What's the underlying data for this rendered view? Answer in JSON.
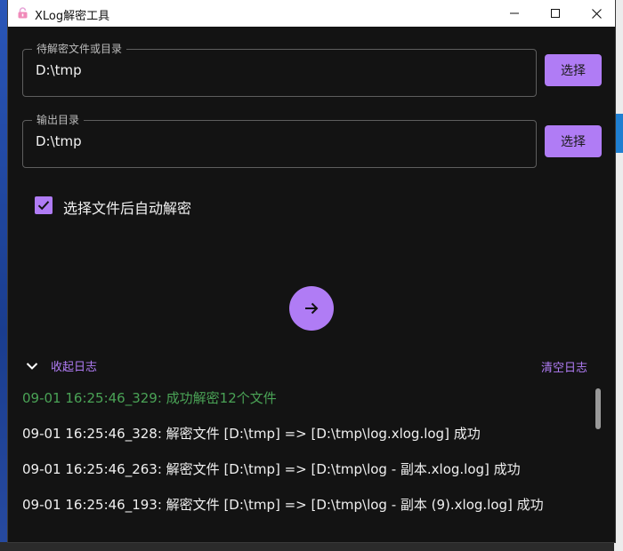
{
  "window": {
    "title": "XLog解密工具"
  },
  "input_dir": {
    "label": "待解密文件或目录",
    "value": "D:\\tmp",
    "button": "选择"
  },
  "output_dir": {
    "label": "输出目录",
    "value": "D:\\tmp",
    "button": "选择"
  },
  "auto_decrypt": {
    "label": "选择文件后自动解密",
    "checked": true
  },
  "log": {
    "collapse_label": "收起日志",
    "clear_label": "清空日志",
    "lines": [
      "09-01 16:25:46_329: 成功解密12个文件",
      "09-01 16:25:46_328: 解密文件 [D:\\tmp] => [D:\\tmp\\log.xlog.log] 成功",
      "09-01 16:25:46_263: 解密文件 [D:\\tmp] => [D:\\tmp\\log - 副本.xlog.log] 成功",
      "09-01 16:25:46_193: 解密文件 [D:\\tmp] => [D:\\tmp\\log - 副本 (9).xlog.log] 成功"
    ]
  },
  "colors": {
    "accent": "#b07cf5",
    "success": "#4aa356",
    "background": "#131313"
  },
  "icons": [
    "lock-icon",
    "minimize-icon",
    "maximize-icon",
    "close-icon",
    "checkmark-icon",
    "arrow-right-icon",
    "chevron-down-icon"
  ]
}
